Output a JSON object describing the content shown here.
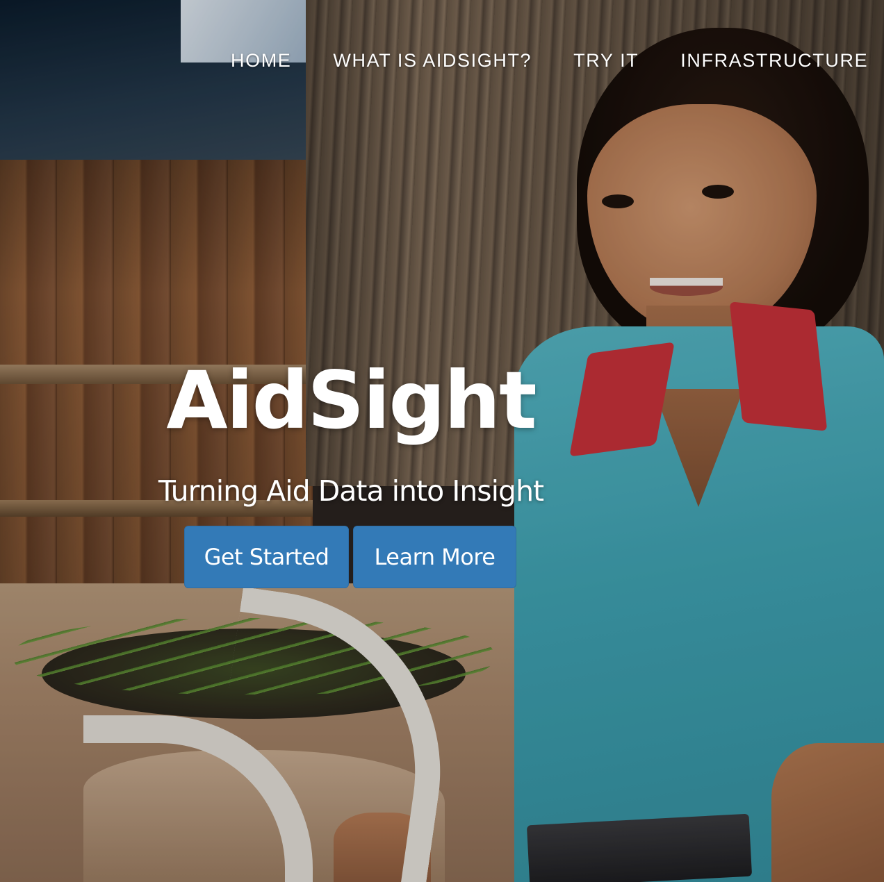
{
  "nav": {
    "items": [
      {
        "label": "HOME"
      },
      {
        "label": "WHAT IS AIDSIGHT?"
      },
      {
        "label": "TRY IT"
      },
      {
        "label": "INFRASTRUCTURE"
      }
    ]
  },
  "hero": {
    "title": "AidSight",
    "tagline": "Turning Aid Data into Insight",
    "buttons": {
      "get_started": "Get Started",
      "learn_more": "Learn More"
    },
    "button_color": "#337ab7"
  },
  "background": {
    "image": "hero-photo"
  }
}
